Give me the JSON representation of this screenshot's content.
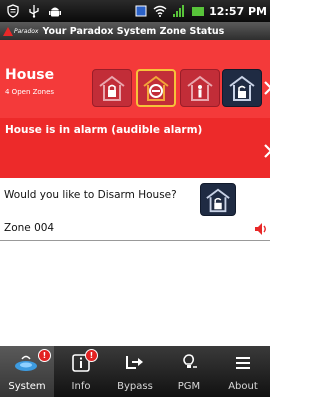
{
  "status_bar": {
    "time": "12:57 PM",
    "icons": [
      "shield-icon",
      "usb-icon",
      "android-icon",
      "screen-icon",
      "wifi-icon",
      "signal-icon",
      "battery-icon"
    ]
  },
  "app_bar": {
    "logo_text": "Paradox",
    "title": "Your Paradox System Zone Status"
  },
  "area": {
    "name": "House",
    "subtitle": "4 Open Zones",
    "modes": [
      "arm-icon",
      "disarm-icon",
      "stay-icon",
      "sleep-icon"
    ]
  },
  "alarm": {
    "message": "House is in alarm (audible alarm)"
  },
  "prompt": {
    "question": "Would you like to Disarm House?"
  },
  "zones": [
    {
      "label": "Zone 004",
      "icon": "speaker-icon"
    }
  ],
  "tabs": [
    {
      "label": "System",
      "icon": "system-icon",
      "badge": "!"
    },
    {
      "label": "Info",
      "icon": "info-icon",
      "badge": "!"
    },
    {
      "label": "Bypass",
      "icon": "bypass-icon"
    },
    {
      "label": "PGM",
      "icon": "pgm-icon"
    },
    {
      "label": "About",
      "icon": "list-icon"
    }
  ],
  "colors": {
    "header_red": "#f43a3a",
    "alarm_red": "#ed2a2a",
    "dark_button": "#1f2b43",
    "active_outline": "#f6c23a"
  }
}
